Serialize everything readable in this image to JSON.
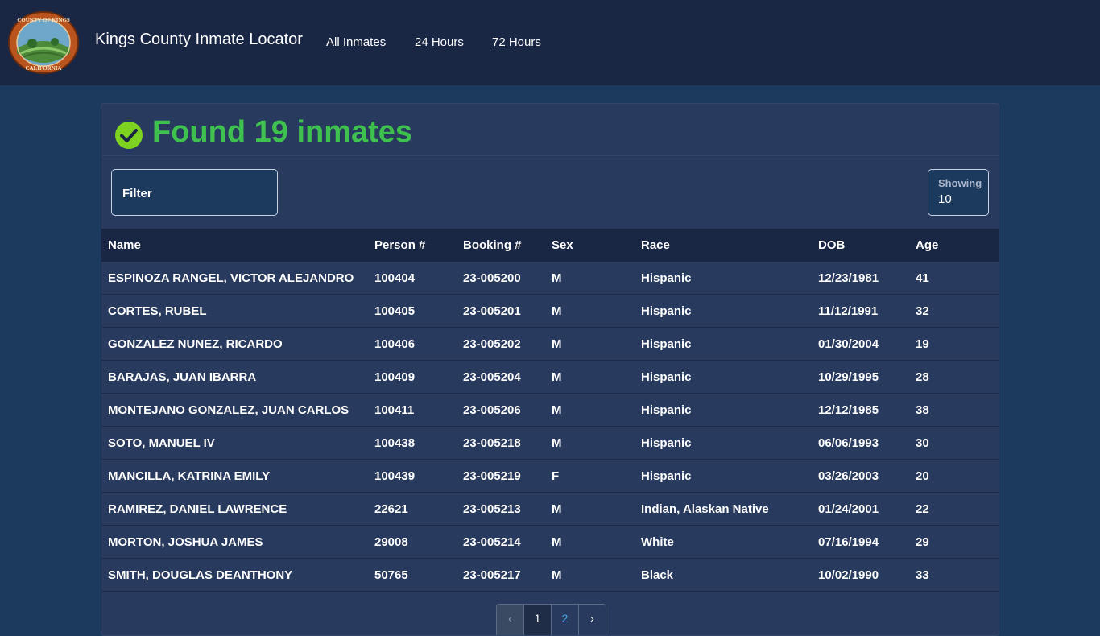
{
  "header": {
    "logo_text_top": "COUNTY OF KINGS",
    "logo_text_bottom": "CALIFORNIA",
    "title": "Kings County Inmate Locator",
    "nav": [
      {
        "label": "All Inmates"
      },
      {
        "label": "24 Hours"
      },
      {
        "label": "72 Hours"
      }
    ]
  },
  "results": {
    "title": "Found 19 inmates",
    "filter_label": "Filter",
    "showing_label": "Showing",
    "showing_value": "10"
  },
  "table": {
    "columns": [
      "Name",
      "Person #",
      "Booking #",
      "Sex",
      "Race",
      "DOB",
      "Age"
    ],
    "rows": [
      [
        "ESPINOZA RANGEL, VICTOR ALEJANDRO",
        "100404",
        "23-005200",
        "M",
        "Hispanic",
        "12/23/1981",
        "41"
      ],
      [
        "CORTES, RUBEL",
        "100405",
        "23-005201",
        "M",
        "Hispanic",
        "11/12/1991",
        "32"
      ],
      [
        "GONZALEZ NUNEZ, RICARDO",
        "100406",
        "23-005202",
        "M",
        "Hispanic",
        "01/30/2004",
        "19"
      ],
      [
        "BARAJAS, JUAN IBARRA",
        "100409",
        "23-005204",
        "M",
        "Hispanic",
        "10/29/1995",
        "28"
      ],
      [
        "MONTEJANO GONZALEZ, JUAN CARLOS",
        "100411",
        "23-005206",
        "M",
        "Hispanic",
        "12/12/1985",
        "38"
      ],
      [
        "SOTO, MANUEL IV",
        "100438",
        "23-005218",
        "M",
        "Hispanic",
        "06/06/1993",
        "30"
      ],
      [
        "MANCILLA, KATRINA EMILY",
        "100439",
        "23-005219",
        "F",
        "Hispanic",
        "03/26/2003",
        "20"
      ],
      [
        "RAMIREZ, DANIEL LAWRENCE",
        "22621",
        "23-005213",
        "M",
        "Indian, Alaskan Native",
        "01/24/2001",
        "22"
      ],
      [
        "MORTON, JOSHUA JAMES",
        "29008",
        "23-005214",
        "M",
        "White",
        "07/16/1994",
        "29"
      ],
      [
        "SMITH, DOUGLAS DEANTHONY",
        "50765",
        "23-005217",
        "M",
        "Black",
        "10/02/1990",
        "33"
      ]
    ]
  },
  "pagination": {
    "pages": [
      "1",
      "2"
    ],
    "current_page": "1"
  },
  "colors": {
    "page_background": "#1b3a5e",
    "navbar": "#1a2744",
    "card": "#283a5d",
    "success_green": "#3fc14f",
    "check_icon_green": "#7ed321",
    "link_blue": "#4aa3e0"
  },
  "icons": {
    "logo": "county-seal-icon",
    "success": "check-circle-icon",
    "prev": "chevron-left-icon",
    "next": "chevron-right-icon"
  }
}
